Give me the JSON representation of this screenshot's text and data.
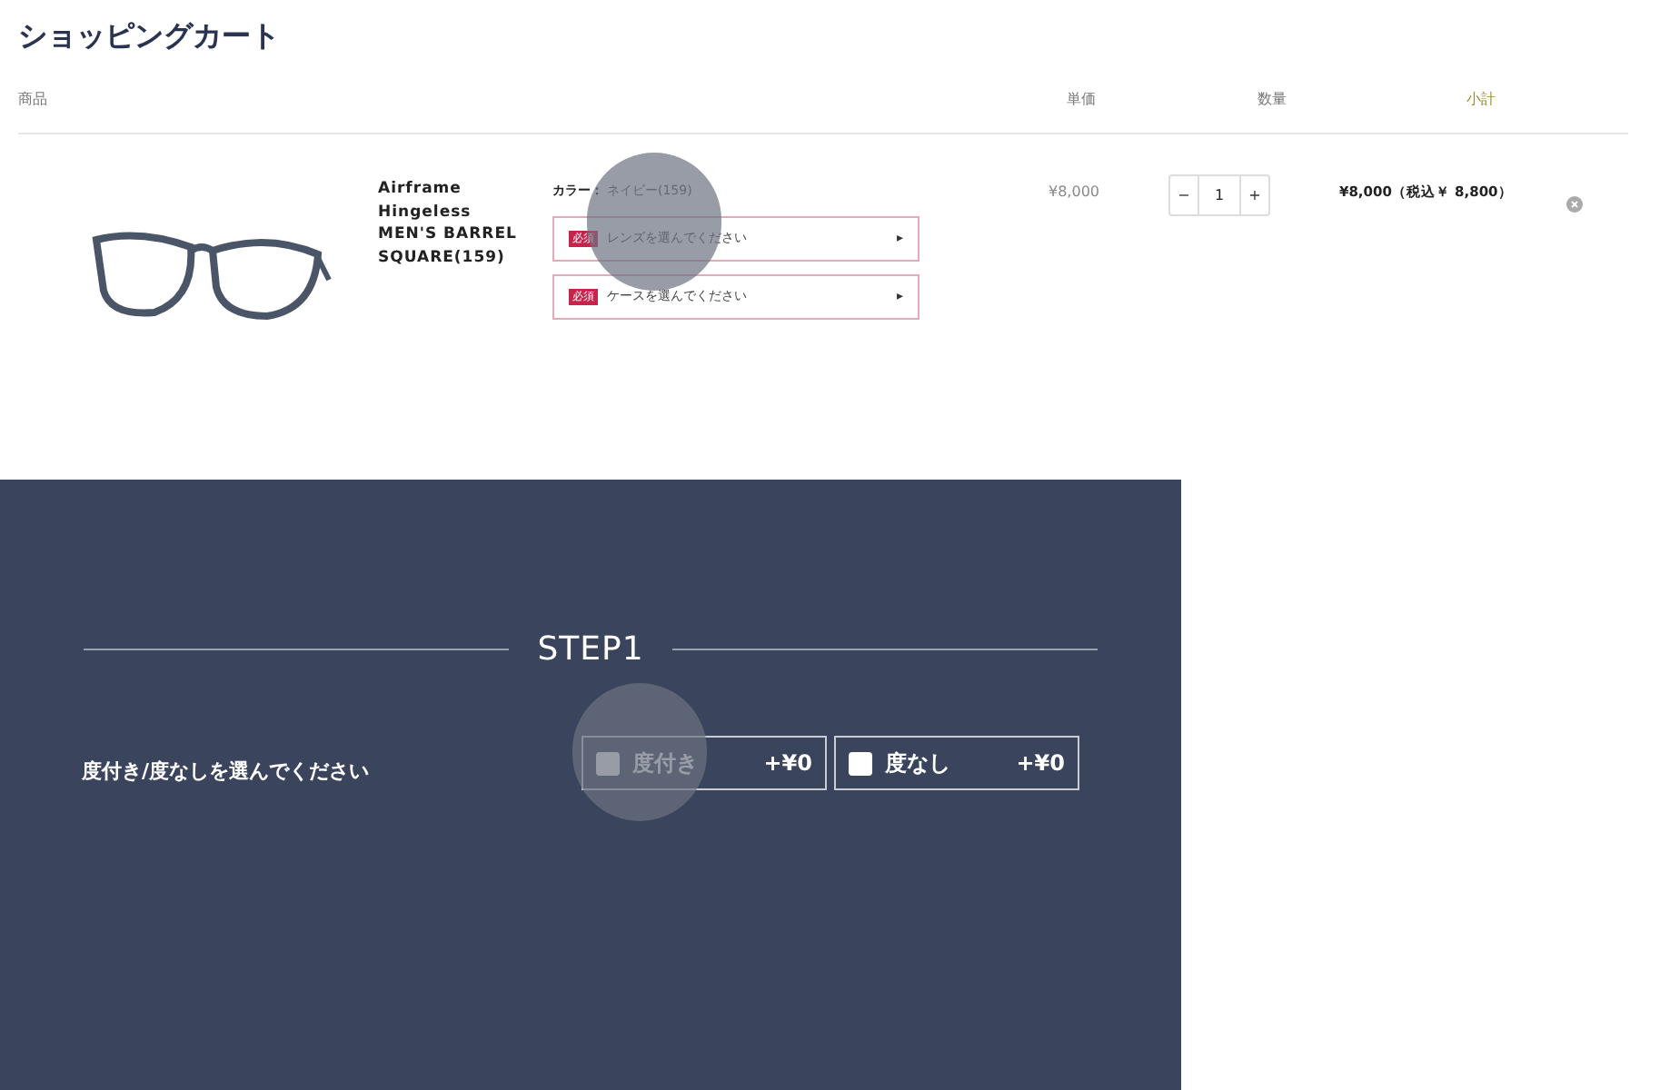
{
  "page_title": "ショッピングカート",
  "columns": [
    "商品",
    "単価",
    "数量",
    "小計"
  ],
  "item": {
    "name": "Airframe Hingeless MEN'S BARREL SQUARE(159)",
    "color_label": "カラー：",
    "color_value": "ネイビー(159)",
    "selects": [
      {
        "badge": "必須",
        "label": "レンズを選んでください",
        "arrow": "▸"
      },
      {
        "badge": "必須",
        "label": "ケースを選んでください",
        "arrow": "▸"
      }
    ],
    "unit_price": "¥8,000",
    "quantity": {
      "minus": "−",
      "value": "1",
      "plus": "+"
    },
    "subtotal": "¥8,000（税込￥ 8,800）"
  },
  "panel": {
    "step": "STEP1",
    "question": "度付き/度なしを選んでください",
    "options": [
      {
        "label": "度付き",
        "price": "+¥0",
        "checked": false
      },
      {
        "label": "度なし",
        "price": "+¥0",
        "checked": false
      }
    ]
  },
  "touches": [
    {
      "kind": "touch"
    },
    {
      "kind": "touch"
    }
  ]
}
